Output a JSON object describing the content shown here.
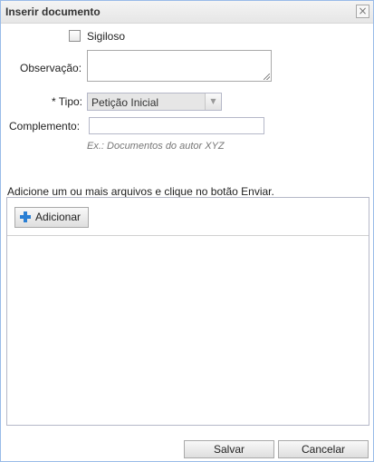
{
  "dialog": {
    "title": "Inserir documento",
    "close_glyph": "☒"
  },
  "form": {
    "sigiloso_label": "Sigiloso",
    "sigiloso_checked": false,
    "observacao_label": "Observação:",
    "observacao_value": "",
    "tipo_label": "* Tipo:",
    "tipo_value": "Petição Inicial",
    "complemento_label": "Complemento:",
    "complemento_value": "",
    "complemento_hint": "Ex.: Documentos do autor XYZ"
  },
  "upload": {
    "instruction": "Adicione um ou mais arquivos e clique no botão Enviar.",
    "add_label": "Adicionar"
  },
  "footer": {
    "save_label": "Salvar",
    "cancel_label": "Cancelar"
  },
  "icons": {
    "close": "close-icon",
    "add": "plus-icon",
    "dropdown": "chevron-down-icon",
    "resize": "resize-grip-icon"
  },
  "colors": {
    "border": "#99bbe8",
    "add_icon": "#2a7fd4"
  }
}
